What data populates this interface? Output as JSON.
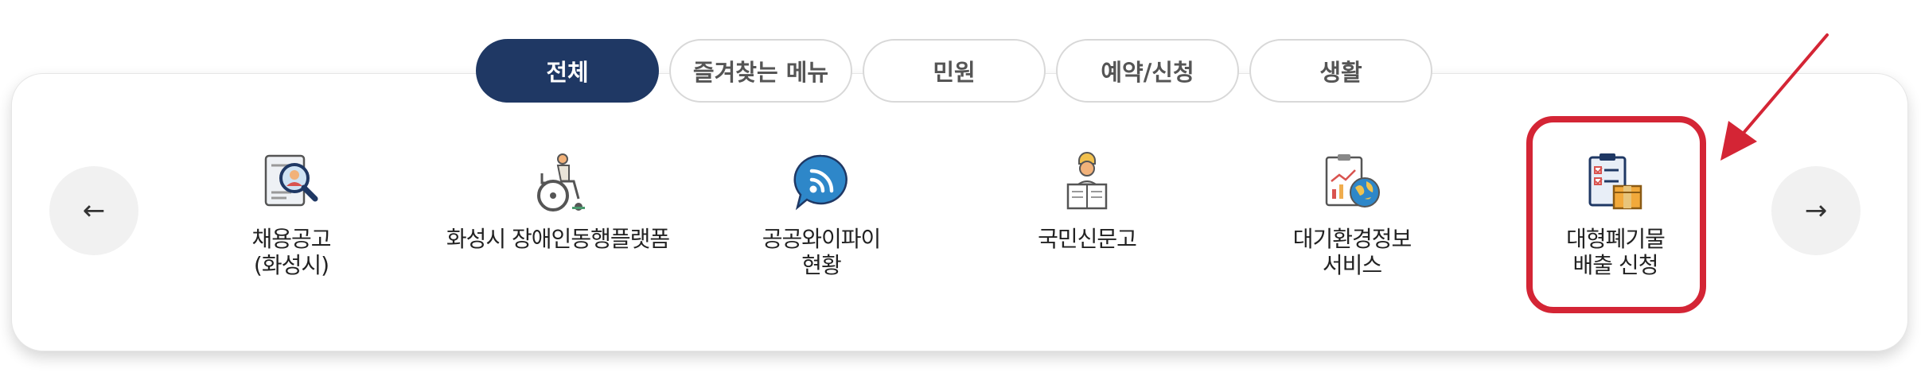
{
  "tabs": [
    {
      "label": "전체",
      "active": true
    },
    {
      "label": "즐겨찾는 메뉴",
      "active": false
    },
    {
      "label": "민원",
      "active": false
    },
    {
      "label": "예약/신청",
      "active": false
    },
    {
      "label": "생활",
      "active": false
    }
  ],
  "nav": {
    "prev": "←",
    "next": "→"
  },
  "items": [
    {
      "line1": "채용공고",
      "line2": "(화성시)",
      "icon": "job-search-icon"
    },
    {
      "line1": "화성시 장애인동행플랫폼",
      "line2": "",
      "icon": "wheelchair-icon"
    },
    {
      "line1": "공공와이파이",
      "line2": "현황",
      "icon": "wifi-icon"
    },
    {
      "line1": "국민신문고",
      "line2": "",
      "icon": "petition-icon"
    },
    {
      "line1": "대기환경정보",
      "line2": "서비스",
      "icon": "air-quality-icon"
    },
    {
      "line1": "대형폐기물",
      "line2": "배출 신청",
      "icon": "waste-clipboard-icon"
    }
  ],
  "colors": {
    "active_tab": "#1f3864",
    "highlight": "#d42535"
  }
}
